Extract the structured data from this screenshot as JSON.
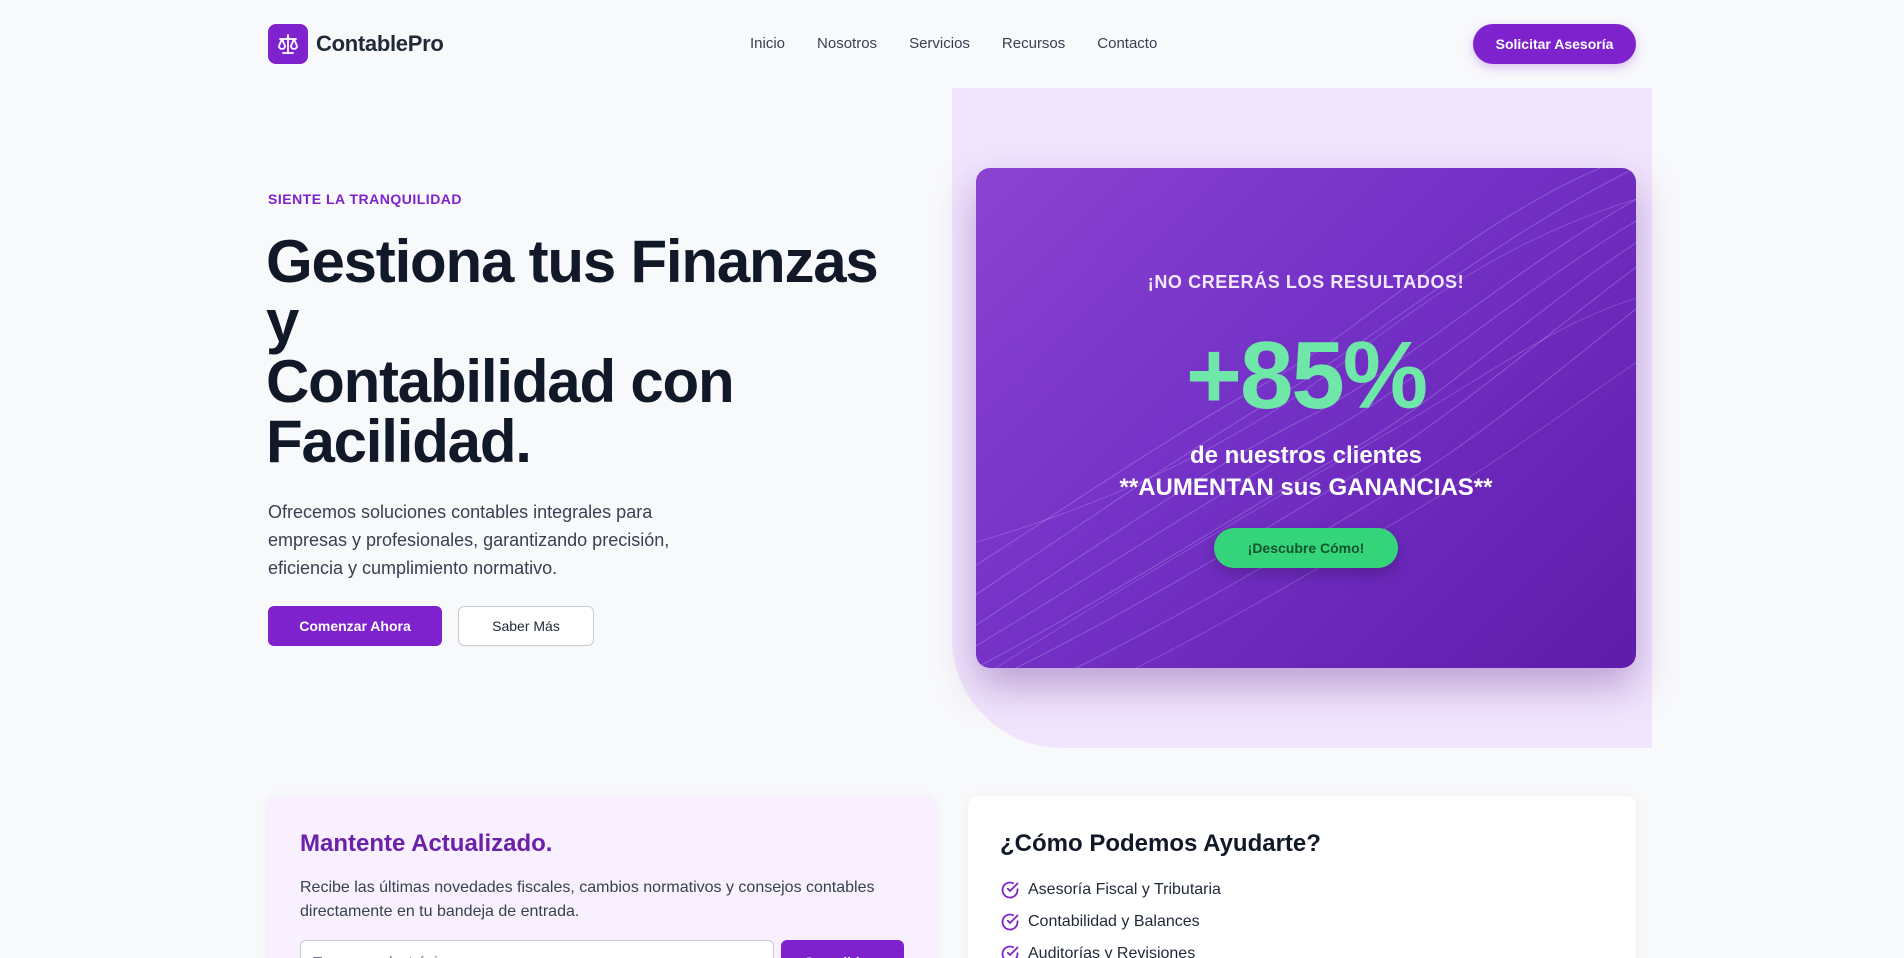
{
  "brand": {
    "name": "ContablePro",
    "icon": "scale-icon",
    "color": "#7e22ce"
  },
  "nav": {
    "items": [
      {
        "label": "Inicio"
      },
      {
        "label": "Nosotros"
      },
      {
        "label": "Servicios"
      },
      {
        "label": "Recursos"
      },
      {
        "label": "Contacto"
      }
    ],
    "cta_label": "Solicitar Asesoría"
  },
  "hero": {
    "eyebrow": "SIENTE LA TRANQUILIDAD",
    "title_lines": [
      "Gestiona tus Finanzas",
      "y",
      "Contabilidad con",
      "Facilidad."
    ],
    "description": "Ofrecemos soluciones contables integrales para empresas y profesionales, garantizando precisión, eficiencia y cumplimiento normativo.",
    "primary_label": "Comenzar Ahora",
    "secondary_label": "Saber Más"
  },
  "promo": {
    "eyebrow": "¡NO CREERÁS LOS RESULTADOS!",
    "big_number": "+85%",
    "line1": "de nuestros clientes",
    "line2": "**AUMENTAN sus GANANCIAS**",
    "button_label": "¡Descubre Cómo!",
    "accent_color": "#6ee7a8"
  },
  "newsletter": {
    "title": "Mantente Actualizado.",
    "description": "Recibe las últimas novedades fiscales, cambios normativos y consejos contables directamente en tu bandeja de entrada.",
    "email_placeholder": "Tu correo electrónico",
    "button_label": "Suscribirse"
  },
  "help": {
    "title": "¿Cómo Podemos Ayudarte?",
    "items": [
      {
        "label": "Asesoría Fiscal y Tributaria"
      },
      {
        "label": "Contabilidad y Balances"
      },
      {
        "label": "Auditorías y Revisiones"
      }
    ],
    "check_icon": "check-circle-icon"
  }
}
